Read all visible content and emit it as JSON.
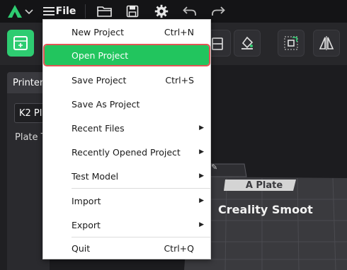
{
  "menubar": {
    "file_label": "File",
    "icons": [
      "logo-icon",
      "chevron-down-icon",
      "hamburger-icon",
      "folder-icon",
      "save-icon",
      "gear-icon",
      "undo-icon",
      "redo-icon"
    ]
  },
  "toolbar": {
    "icons": [
      "add-plate-icon",
      "object-icon",
      "paint-icon",
      "arrange-icon",
      "mirror-icon"
    ]
  },
  "panel": {
    "header": "Printer",
    "printer_value": "K2 Plu",
    "plate_type_label": "Plate T"
  },
  "viewport": {
    "plate_tab": "A Plate",
    "bed_text": "Creality Smoot"
  },
  "file_menu": {
    "items": [
      {
        "label": "New Project",
        "shortcut": "Ctrl+N"
      },
      {
        "label": "Open Project",
        "shortcut": ""
      },
      {
        "label": "Save Project",
        "shortcut": "Ctrl+S"
      },
      {
        "label": "Save As Project",
        "shortcut": ""
      },
      {
        "label": "Recent Files",
        "shortcut": ""
      },
      {
        "label": "Recently Opened Project",
        "shortcut": ""
      },
      {
        "label": "Test Model",
        "shortcut": ""
      },
      {
        "label": "Import",
        "shortcut": ""
      },
      {
        "label": "Export",
        "shortcut": ""
      },
      {
        "label": "Quit",
        "shortcut": "Ctrl+Q"
      }
    ]
  },
  "colors": {
    "accent": "#22c55e",
    "highlight_border": "#e25555"
  }
}
